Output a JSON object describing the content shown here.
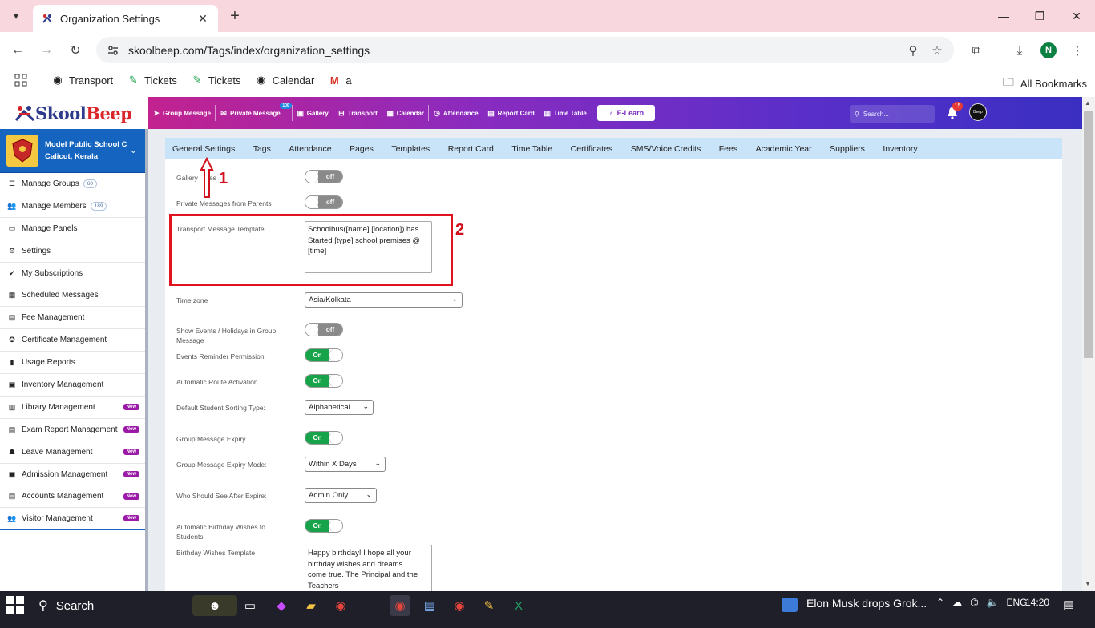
{
  "browser": {
    "tab_title": "Organization Settings",
    "url": "skoolbeep.com/Tags/index/organization_settings",
    "profile_initial": "N",
    "bookmarks": [
      "Transport",
      "Tickets",
      "Tickets",
      "Calendar",
      "a"
    ],
    "all_bookmarks": "All Bookmarks"
  },
  "app": {
    "logo_part1": "Skool",
    "logo_part2": "Beep",
    "topnav": {
      "items": [
        "Group Message",
        "Private Message",
        "Gallery",
        "Transport",
        "Calendar",
        "Attendance",
        "Report Card",
        "Time Table"
      ],
      "message_badge": "100",
      "elearn": "E-Learn",
      "search_placeholder": "Search...",
      "bell_count": "15",
      "avatar_text": "Beep"
    },
    "school": {
      "name": "Model Public School C",
      "location": "Calicut, Kerala"
    },
    "sidebar": [
      {
        "label": "Manage Groups",
        "count": "60"
      },
      {
        "label": "Manage Members",
        "count": "189"
      },
      {
        "label": "Manage Panels"
      },
      {
        "label": "Settings"
      },
      {
        "label": "My Subscriptions"
      },
      {
        "label": "Scheduled Messages"
      },
      {
        "label": "Fee Management"
      },
      {
        "label": "Certificate Management"
      },
      {
        "label": "Usage Reports"
      },
      {
        "label": "Inventory Management"
      },
      {
        "label": "Library Management",
        "badge": "New"
      },
      {
        "label": "Exam Report Management",
        "badge": "New"
      },
      {
        "label": "Leave Management",
        "badge": "New"
      },
      {
        "label": "Admission Management",
        "badge": "New"
      },
      {
        "label": "Accounts Management",
        "badge": "New"
      },
      {
        "label": "Visitor Management",
        "badge": "New"
      }
    ],
    "subtabs": [
      "General Settings",
      "Tags",
      "Attendance",
      "Pages",
      "Templates",
      "Report Card",
      "Time Table",
      "Certificates",
      "SMS/Voice Credits",
      "Fees",
      "Academic Year",
      "Suppliers",
      "Inventory"
    ],
    "settings": {
      "gallery_label": "Gallery",
      "gallery_label_tail": "es",
      "gallery_state": "off",
      "private_label": "Private Messages from Parents",
      "private_state": "off",
      "transport_label": "Transport Message Template",
      "transport_template": "Schoolbus([name] [location]) has Started [type] school premises @ [time]",
      "timezone_label": "Time zone",
      "timezone_value": "Asia/Kolkata",
      "events_holidays_label": "Show Events / Holidays in Group Message",
      "events_holidays_state": "off",
      "events_reminder_label": "Events Reminder Permission",
      "events_reminder_state": "On",
      "auto_route_label": "Automatic Route Activation",
      "auto_route_state": "On",
      "sorting_label": "Default Student Sorting Type:",
      "sorting_value": "Alphabetical",
      "expiry_label": "Group Message Expiry",
      "expiry_state": "On",
      "expiry_mode_label": "Group Message Expiry Mode:",
      "expiry_mode_value": "Within X Days",
      "who_see_label": "Who Should See After Expire:",
      "who_see_value": "Admin Only",
      "birthday_auto_label": "Automatic Birthday Wishes to Students",
      "birthday_auto_state": "On",
      "birthday_template_label": "Birthday Wishes Template",
      "birthday_template": "Happy birthday! I hope all your birthday wishes and dreams come true. The Principal and the Teachers"
    },
    "annotations": {
      "one": "1",
      "two": "2"
    }
  },
  "taskbar": {
    "search": "Search",
    "news": "Elon Musk drops Grok...",
    "lang": "ENG",
    "time": "14:20"
  },
  "colors": {
    "accent_blue": "#1565c0",
    "toggle_on": "#17a34a",
    "toggle_off": "#8a8a8a",
    "new_badge": "#9c1aa8",
    "annotation_red": "#e0141e"
  }
}
